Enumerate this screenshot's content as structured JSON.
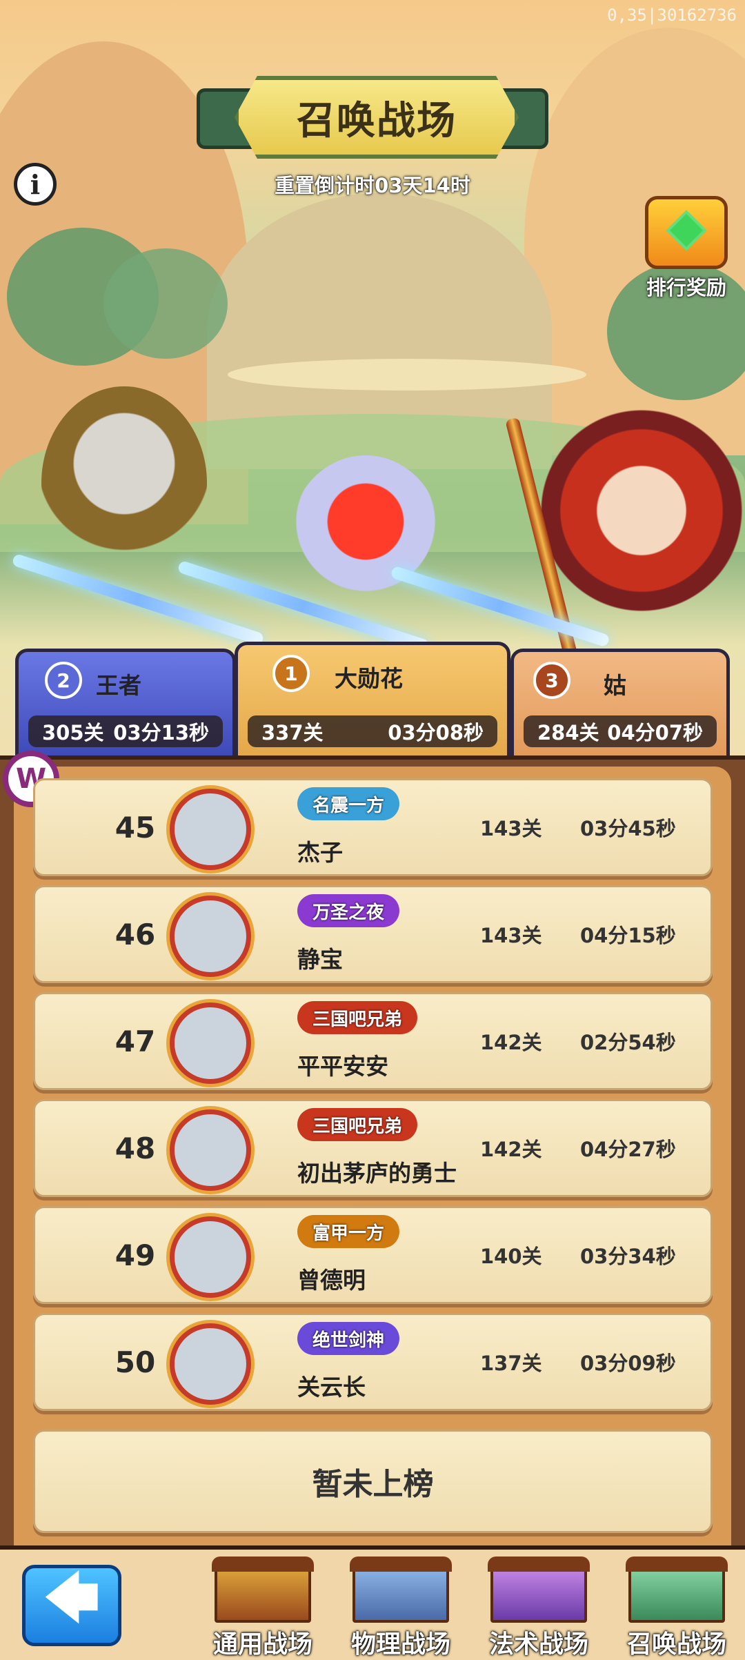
{
  "version": "0,35|30162736",
  "header": {
    "title": "召唤战场",
    "countdown": "重置倒计时03天14时",
    "info_icon": "i",
    "reward_label": "排行奖励"
  },
  "top3": [
    {
      "rank": "2",
      "name": "王者",
      "stage": "305关",
      "time": "03分13秒",
      "color": "#5a68d8"
    },
    {
      "rank": "1",
      "name": "大勋花",
      "stage": "337关",
      "time": "03分08秒",
      "color": "#e6a53a"
    },
    {
      "rank": "3",
      "name": "姑",
      "stage": "284关",
      "time": "04分07秒",
      "color": "#c2652a"
    }
  ],
  "leaderboard": [
    {
      "rank": "45",
      "title": "名震一方",
      "name": "杰子",
      "stage": "143关",
      "time": "03分45秒",
      "tag_color": "#3aa0d8"
    },
    {
      "rank": "46",
      "title": "万圣之夜",
      "name": "静宝",
      "stage": "143关",
      "time": "04分15秒",
      "tag_color": "#8a3ad0"
    },
    {
      "rank": "47",
      "title": "三国吧兄弟",
      "name": "平平安安",
      "stage": "142关",
      "time": "02分54秒",
      "tag_color": "#c8361e"
    },
    {
      "rank": "48",
      "title": "三国吧兄弟",
      "name": "初出茅庐的勇士",
      "stage": "142关",
      "time": "04分27秒",
      "tag_color": "#c8361e"
    },
    {
      "rank": "49",
      "title": "富甲一方",
      "name": "曾德明",
      "stage": "140关",
      "time": "03分34秒",
      "tag_color": "#d07a10"
    },
    {
      "rank": "50",
      "title": "绝世剑神",
      "name": "关云长",
      "stage": "137关",
      "time": "03分09秒",
      "tag_color": "#6a4ad8"
    }
  ],
  "self_status": "暂未上榜",
  "w_icon": "W",
  "nav": {
    "back_icon": "🡄",
    "tabs": [
      "通用战场",
      "物理战场",
      "法术战场",
      "召唤战场"
    ]
  }
}
